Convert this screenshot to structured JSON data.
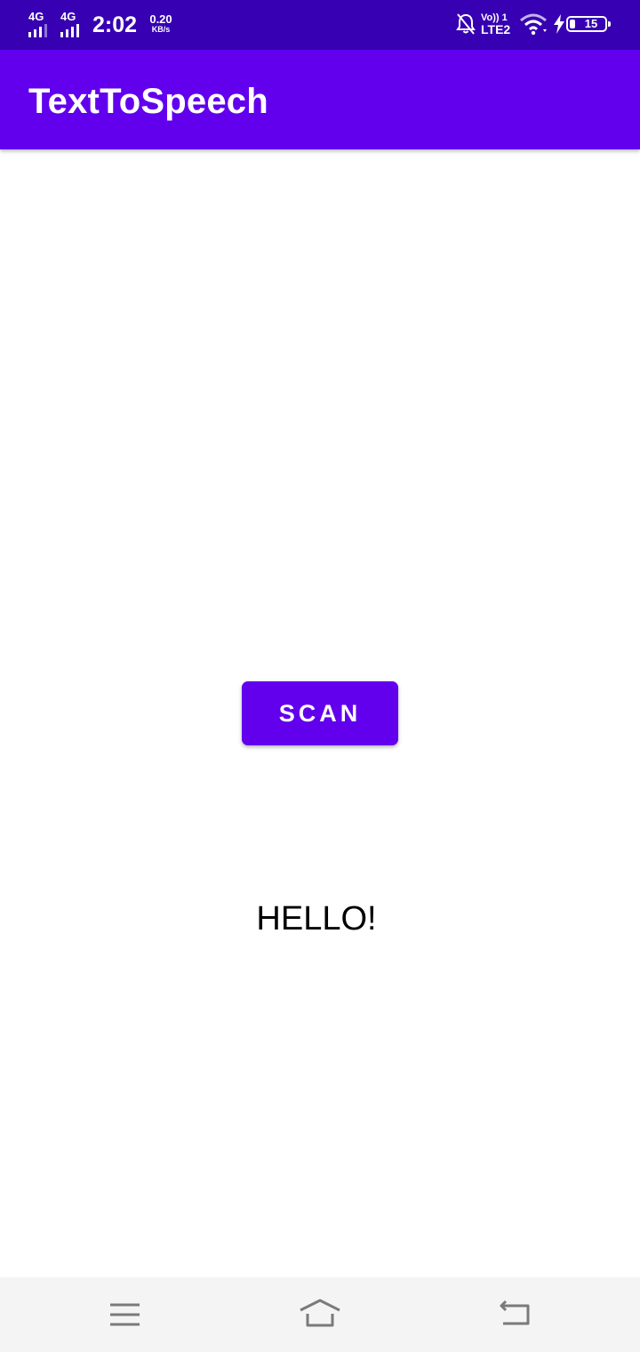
{
  "status_bar": {
    "sim1_network": "4G",
    "sim2_network": "4G",
    "time": "2:02",
    "data_speed_value": "0.20",
    "data_speed_unit": "KB/s",
    "volte_line1": "Vo)) 1",
    "volte_line2": "LTE2",
    "battery_level": "15",
    "icons": [
      "signal-icon",
      "signal-icon",
      "bell-off-icon",
      "wifi-icon",
      "charging-bolt-icon",
      "battery-icon"
    ],
    "background_color": "#3700b3"
  },
  "app_bar": {
    "title": "TextToSpeech",
    "background_color": "#6200ee"
  },
  "main": {
    "scan_button_label": "SCAN",
    "output_text": "HELLO!"
  },
  "nav_bar": {
    "icons": [
      "menu-icon",
      "home-icon",
      "back-icon"
    ],
    "background_color": "#f4f4f4"
  }
}
